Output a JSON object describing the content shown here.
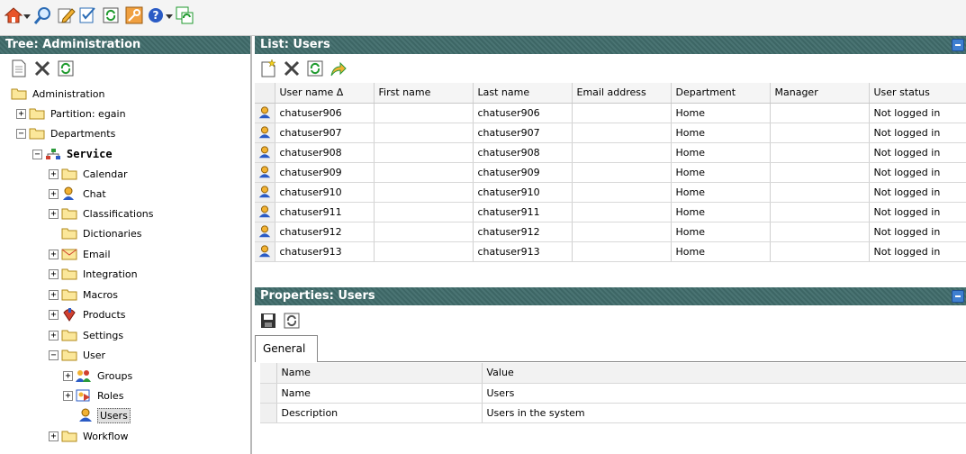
{
  "toolbar": {
    "items": [
      "home-icon",
      "search-icon",
      "edit-icon",
      "checklist-icon",
      "refresh-icon",
      "key-icon",
      "help-icon",
      "sync-icon"
    ]
  },
  "tree": {
    "title": "Tree: Administration",
    "nodes": [
      {
        "label": "Administration"
      },
      {
        "label": "Partition: egain"
      },
      {
        "label": "Departments"
      },
      {
        "label": "Service"
      },
      {
        "label": "Calendar"
      },
      {
        "label": "Chat"
      },
      {
        "label": "Classifications"
      },
      {
        "label": "Dictionaries"
      },
      {
        "label": "Email"
      },
      {
        "label": "Integration"
      },
      {
        "label": "Macros"
      },
      {
        "label": "Products"
      },
      {
        "label": "Settings"
      },
      {
        "label": "User"
      },
      {
        "label": "Groups"
      },
      {
        "label": "Roles"
      },
      {
        "label": "Users"
      },
      {
        "label": "Workflow"
      }
    ]
  },
  "list": {
    "title": "List: Users",
    "columns": [
      "User name Δ",
      "First name",
      "Last name",
      "Email address",
      "Department",
      "Manager",
      "User status"
    ],
    "rows": [
      [
        "chatuser906",
        "",
        "chatuser906",
        "",
        "Home",
        "",
        "Not logged in"
      ],
      [
        "chatuser907",
        "",
        "chatuser907",
        "",
        "Home",
        "",
        "Not logged in"
      ],
      [
        "chatuser908",
        "",
        "chatuser908",
        "",
        "Home",
        "",
        "Not logged in"
      ],
      [
        "chatuser909",
        "",
        "chatuser909",
        "",
        "Home",
        "",
        "Not logged in"
      ],
      [
        "chatuser910",
        "",
        "chatuser910",
        "",
        "Home",
        "",
        "Not logged in"
      ],
      [
        "chatuser911",
        "",
        "chatuser911",
        "",
        "Home",
        "",
        "Not logged in"
      ],
      [
        "chatuser912",
        "",
        "chatuser912",
        "",
        "Home",
        "",
        "Not logged in"
      ],
      [
        "chatuser913",
        "",
        "chatuser913",
        "",
        "Home",
        "",
        "Not logged in"
      ]
    ]
  },
  "properties": {
    "title": "Properties: Users",
    "tab": "General",
    "header": [
      "Name",
      "Value"
    ],
    "rows": [
      [
        "Name",
        "Users"
      ],
      [
        "Description",
        "Users in the system"
      ]
    ]
  },
  "colors": {
    "header_bg": "#3d6665",
    "panel_button": "#3f7fd0"
  }
}
